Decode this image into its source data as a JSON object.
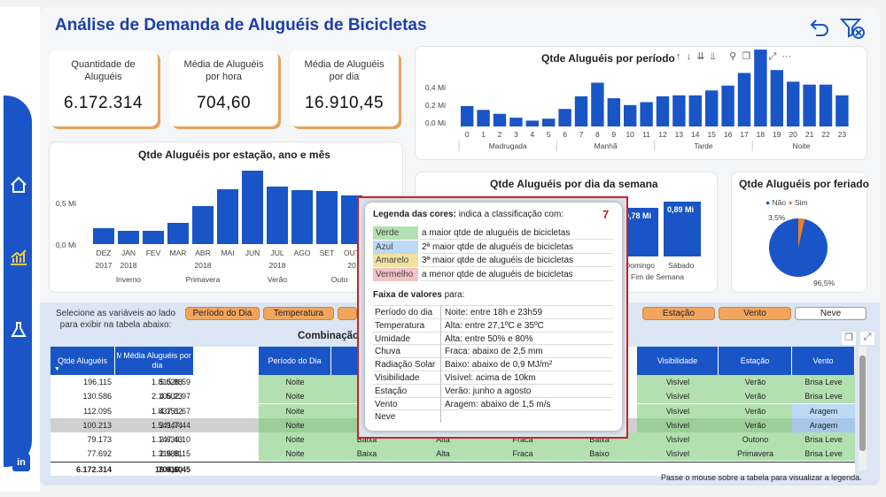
{
  "title": "Análise de Demanda de Aluguéis de Bicicletas",
  "colors": {
    "accent": "#1a55c7",
    "orange": "#f2a55d",
    "green": "#b3e0b0",
    "blue": "#bcd9f5",
    "yellow": "#f3e1a0",
    "red": "#f4c2c6"
  },
  "kpis": [
    {
      "label": "Quantidade de Aluguéis",
      "value": "6.172.314"
    },
    {
      "label": "Média de Aluguéis por hora",
      "value": "704,60"
    },
    {
      "label": "Média de Aluguéis por dia",
      "value": "16.910,45"
    }
  ],
  "chart_data": [
    {
      "type": "bar",
      "title": "Qtde Aluguéis por período do dia",
      "yticks": [
        "0,4 Mi",
        "0,2 Mi",
        "0,0 Mi"
      ],
      "categories": [
        "0",
        "1",
        "2",
        "3",
        "4",
        "5",
        "6",
        "7",
        "8",
        "9",
        "10",
        "11",
        "12",
        "13",
        "14",
        "15",
        "16",
        "17",
        "18",
        "19",
        "20",
        "21",
        "22",
        "23"
      ],
      "values": [
        0.21,
        0.17,
        0.13,
        0.09,
        0.06,
        0.08,
        0.18,
        0.31,
        0.45,
        0.29,
        0.22,
        0.25,
        0.31,
        0.32,
        0.32,
        0.37,
        0.42,
        0.55,
        0.79,
        0.58,
        0.46,
        0.43,
        0.43,
        0.32
      ],
      "groups": [
        "Madrugada",
        "Manhã",
        "Tarde",
        "Noite"
      ]
    },
    {
      "type": "bar",
      "title": "Qtde Aluguéis por estação, ano e mês",
      "yticks": [
        "0,5 Mi",
        "0,0 Mi"
      ],
      "months": [
        "DEZ",
        "JAN",
        "FEV",
        "MAR",
        "ABR",
        "MAI",
        "JUN",
        "JUL",
        "AGO",
        "SET",
        "OUT"
      ],
      "years": [
        "2017",
        "2018",
        "",
        "",
        "2018",
        "",
        "",
        "2018",
        "",
        "",
        "20"
      ],
      "values": [
        0.18,
        0.15,
        0.15,
        0.24,
        0.43,
        0.62,
        0.83,
        0.65,
        0.61,
        0.6,
        0.55
      ],
      "seasons": [
        "Inverno",
        "Primavera",
        "Verão",
        "Outo"
      ]
    },
    {
      "type": "bar",
      "title": "Qtde Aluguéis por dia da semana",
      "labels": [
        {
          "value": "0,78 Mi",
          "cat": "Domingo"
        },
        {
          "value": "0,89 Mi",
          "cat": "Sábado"
        }
      ],
      "group": "Fim de Semana"
    },
    {
      "type": "pie",
      "title": "Qtde Aluguéis por feriado",
      "legend": [
        "Não",
        "Sim"
      ],
      "values": [
        96.5,
        3.5
      ],
      "labels": [
        "96,5%",
        "3,5%"
      ]
    }
  ],
  "filters": {
    "prompt": "Selecione as variáveis ao lado para exibir na tabela abaixo:",
    "buttons": [
      "Período do Dia",
      "Temperatura",
      "Estação",
      "Vento",
      "Neve"
    ]
  },
  "table": {
    "title": "Combinação",
    "headers": [
      "Qtde Aluguéis",
      "Média Aluguéis por hora",
      "Média Aluguéis por dia",
      "Período do Dia",
      "Te",
      "Visibilidade",
      "Estação",
      "Vento"
    ],
    "rows": [
      [
        "196.115",
        "1.815,88",
        "5.028,59",
        "Noite",
        "",
        "Visível",
        "Verão",
        "Brisa Leve"
      ],
      [
        "130.586",
        "2.106,23",
        "4.502,97",
        "Noite",
        "",
        "Visível",
        "Verão",
        "Brisa Leve"
      ],
      [
        "112.095",
        "1.837,62",
        "4.151,67",
        "Noite",
        "",
        "Visível",
        "Verão",
        "Aragem"
      ],
      [
        "100.213",
        "1.541,74",
        "2.947,44",
        "Noite",
        "",
        "Visível",
        "Verão",
        "Aragem"
      ],
      [
        "79.173",
        "1.147,43",
        "2.639,10",
        "Noite",
        "Baixa",
        "Alta",
        "Fraca",
        "Baixa",
        "Visível",
        "Outono",
        "Brisa Leve"
      ],
      [
        "77.692",
        "1.316,81",
        "2.988,15",
        "Noite",
        "Baixa",
        "Alta",
        "Fraca",
        "Baixo",
        "Visível",
        "Primavera",
        "Brisa Leve"
      ]
    ],
    "totals": [
      "6.172.314",
      "704,60",
      "16.910,45"
    ],
    "hint": "Passe o mouse sobre a tabela para visualizar a legenda."
  },
  "tooltip": {
    "number": "7",
    "legend_title": "Legenda das cores:",
    "legend_desc": " indica a classificação com:",
    "legend": [
      {
        "color": "Verde",
        "text": "a maior qtde de aluguéis de bicicletas"
      },
      {
        "color": "Azul",
        "text": "2ª maior qtde de aluguéis de bicicletas"
      },
      {
        "color": "Amarelo",
        "text": "3ª maior qtde de aluguéis de bicicletas"
      },
      {
        "color": "Vermelho",
        "text": "a menor qtde de aluguéis de bicicletas"
      }
    ],
    "ranges_title": "Faixa de valores",
    "ranges_desc": " para:",
    "ranges": [
      {
        "k": "Período do dia",
        "v": "Noite: entre 18h e 23h59"
      },
      {
        "k": "Temperatura",
        "v": "Alta: entre 27,1ºC e 35ºC"
      },
      {
        "k": "Umidade",
        "v": "Alta: entre 50% e 80%"
      },
      {
        "k": "Chuva",
        "v": "Fraca: abaixo de 2,5 mm"
      },
      {
        "k": "Radiação Solar",
        "v": "Baixo: abaixo de 0,9 MJ/m²"
      },
      {
        "k": "Visibilidade",
        "v": "Visível: acima de 10km"
      },
      {
        "k": "Estação",
        "v": "Verão: junho a agosto"
      },
      {
        "k": "Vento",
        "v": "Aragem: abaixo de 1,5 m/s"
      },
      {
        "k": "Neve",
        "v": ""
      }
    ]
  }
}
